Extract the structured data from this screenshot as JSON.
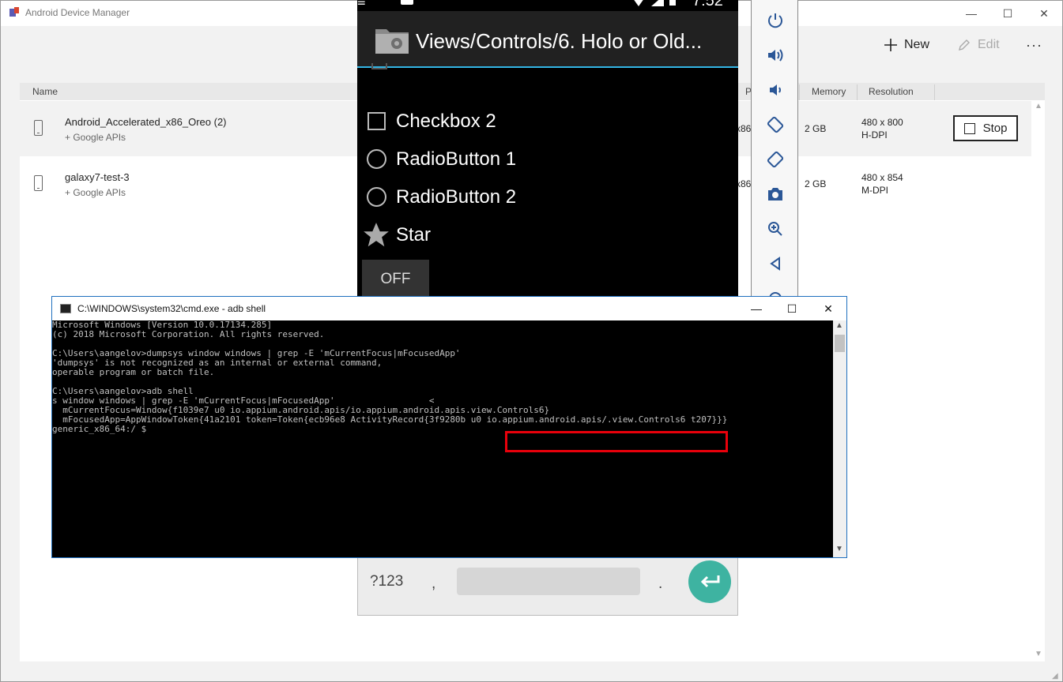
{
  "adm": {
    "title": "Android Device Manager",
    "window_controls": {
      "minimize": "—",
      "maximize": "☐",
      "close": "✕"
    },
    "commands": {
      "new_label": "New",
      "edit_label": "Edit",
      "more_label": "···"
    },
    "columns": {
      "name": "Name",
      "p": "P",
      "memory": "Memory",
      "resolution": "Resolution"
    },
    "devices": [
      {
        "name": "Android_Accelerated_x86_Oreo (2)",
        "sub": "+ Google APIs",
        "arch_fragment": "x86",
        "memory": "2 GB",
        "resolution": "480 x 800",
        "density": "H-DPI",
        "action": "Stop"
      },
      {
        "name": "galaxy7-test-3",
        "sub": "+ Google APIs",
        "arch_fragment": "x86",
        "memory": "2 GB",
        "resolution": "480 x 854",
        "density": "M-DPI"
      }
    ]
  },
  "emulator": {
    "status_time": "7:52",
    "toolbar_title": "Views/Controls/6. Holo or Old...",
    "controls": {
      "checkbox2": "Checkbox 2",
      "radio1": "RadioButton 1",
      "radio2": "RadioButton 2",
      "star": "Star",
      "toggle": "OFF"
    },
    "keyboard": {
      "symbols": "?123",
      "comma": ",",
      "period": "."
    },
    "accent_color": "#33b5e5",
    "enter_color": "#3eb3a1"
  },
  "cmd": {
    "title": "C:\\WINDOWS\\system32\\cmd.exe - adb  shell",
    "lines": [
      "Microsoft Windows [Version 10.0.17134.285]",
      "(c) 2018 Microsoft Corporation. All rights reserved.",
      "",
      "C:\\Users\\aangelov>dumpsys window windows | grep -E 'mCurrentFocus|mFocusedApp'",
      "'dumpsys' is not recognized as an internal or external command,",
      "operable program or batch file.",
      "",
      "C:\\Users\\aangelov>adb shell",
      "s window windows | grep -E 'mCurrentFocus|mFocusedApp'                  <",
      "  mCurrentFocus=Window{f1039e7 u0 io.appium.android.apis/io.appium.android.apis.view.Controls6}",
      "  mFocusedApp=AppWindowToken{41a2101 token=Token{ecb96e8 ActivityRecord{3f9280b u0 io.appium.android.apis/.view.Controls6 t207}}}",
      "generic_x86_64:/ $"
    ],
    "highlight_color": "#e8000b"
  }
}
